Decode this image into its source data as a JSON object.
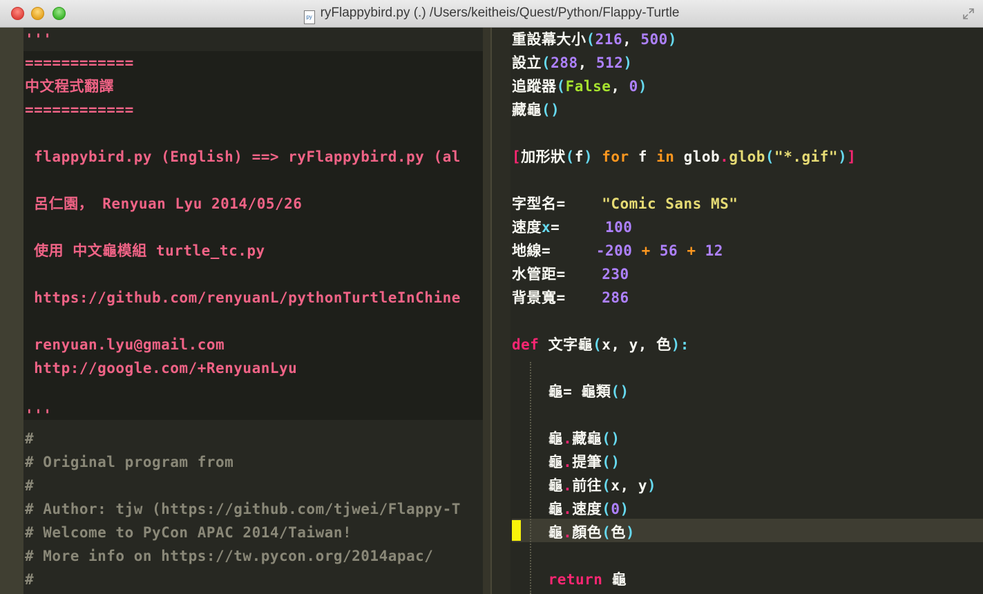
{
  "window": {
    "title": "ryFlappybird.py (.) /Users/keitheis/Quest/Python/Flappy-Turtle",
    "file_icon_label": "py"
  },
  "left_pane": {
    "lines": [
      {
        "text": "'''",
        "cls": "str"
      },
      {
        "text": "============",
        "cls": "str"
      },
      {
        "text": "中文程式翻譯",
        "cls": "str"
      },
      {
        "text": "============",
        "cls": "str"
      },
      {
        "text": "",
        "cls": "str"
      },
      {
        "text": " flappybird.py (English) ==> ryFlappybird.py (al",
        "cls": "str"
      },
      {
        "text": "",
        "cls": "str"
      },
      {
        "text": " 呂仁園， Renyuan Lyu 2014/05/26",
        "cls": "str"
      },
      {
        "text": "",
        "cls": "str"
      },
      {
        "text": " 使用 中文龜模組 turtle_tc.py",
        "cls": "str"
      },
      {
        "text": "",
        "cls": "str"
      },
      {
        "text": " https://github.com/renyuanL/pythonTurtleInChine",
        "cls": "str"
      },
      {
        "text": "",
        "cls": "str"
      },
      {
        "text": " renyuan.lyu@gmail.com",
        "cls": "str"
      },
      {
        "text": " http://google.com/+RenyuanLyu",
        "cls": "str"
      },
      {
        "text": "",
        "cls": "str"
      },
      {
        "text": "'''",
        "cls": "str"
      },
      {
        "text": "#",
        "cls": "cmt"
      },
      {
        "text": "# Original program from",
        "cls": "cmt"
      },
      {
        "text": "#",
        "cls": "cmt"
      },
      {
        "text": "# Author: tjw (https://github.com/tjwei/Flappy-T",
        "cls": "cmt"
      },
      {
        "text": "# Welcome to PyCon APAC 2014/Taiwan!",
        "cls": "cmt"
      },
      {
        "text": "# More info on https://tw.pycon.org/2014apac/",
        "cls": "cmt"
      },
      {
        "text": "#",
        "cls": "cmt"
      }
    ]
  },
  "right_pane": {
    "lines": [
      [
        {
          "t": "重設幕大小",
          "c": "white"
        },
        {
          "t": "(",
          "c": "cyan"
        },
        {
          "t": "216",
          "c": "purple"
        },
        {
          "t": ", ",
          "c": "white"
        },
        {
          "t": "500",
          "c": "purple"
        },
        {
          "t": ")",
          "c": "cyan"
        }
      ],
      [
        {
          "t": "設立",
          "c": "white"
        },
        {
          "t": "(",
          "c": "cyan"
        },
        {
          "t": "288",
          "c": "purple"
        },
        {
          "t": ", ",
          "c": "white"
        },
        {
          "t": "512",
          "c": "purple"
        },
        {
          "t": ")",
          "c": "cyan"
        }
      ],
      [
        {
          "t": "追蹤器",
          "c": "white"
        },
        {
          "t": "(",
          "c": "cyan"
        },
        {
          "t": "False",
          "c": "green"
        },
        {
          "t": ", ",
          "c": "white"
        },
        {
          "t": "0",
          "c": "purple"
        },
        {
          "t": ")",
          "c": "cyan"
        }
      ],
      [
        {
          "t": "藏龜",
          "c": "white"
        },
        {
          "t": "()",
          "c": "cyan"
        }
      ],
      [],
      [
        {
          "t": "[",
          "c": "red"
        },
        {
          "t": "加形狀",
          "c": "white"
        },
        {
          "t": "(",
          "c": "cyan"
        },
        {
          "t": "f",
          "c": "white"
        },
        {
          "t": ")",
          "c": "cyan"
        },
        {
          "t": " for ",
          "c": "orange"
        },
        {
          "t": "f",
          "c": "white"
        },
        {
          "t": " in ",
          "c": "orange"
        },
        {
          "t": "glob",
          "c": "white"
        },
        {
          "t": ".",
          "c": "pink"
        },
        {
          "t": "glob",
          "c": "yellow"
        },
        {
          "t": "(",
          "c": "cyan"
        },
        {
          "t": "\"*.gif\"",
          "c": "yellow"
        },
        {
          "t": ")",
          "c": "cyan"
        },
        {
          "t": "]",
          "c": "red"
        }
      ],
      [],
      [
        {
          "t": "字型名= ",
          "c": "white"
        },
        {
          "t": "   \"Comic Sans MS\"",
          "c": "yellow"
        }
      ],
      [
        {
          "t": "速度",
          "c": "white"
        },
        {
          "t": "x",
          "c": "cyan"
        },
        {
          "t": "= ",
          "c": "white"
        },
        {
          "t": "    100",
          "c": "purple"
        }
      ],
      [
        {
          "t": "地線=",
          "c": "white"
        },
        {
          "t": "     -200",
          "c": "purple"
        },
        {
          "t": " + ",
          "c": "orange"
        },
        {
          "t": "56",
          "c": "purple"
        },
        {
          "t": " + ",
          "c": "orange"
        },
        {
          "t": "12",
          "c": "purple"
        }
      ],
      [
        {
          "t": "水管距=",
          "c": "white"
        },
        {
          "t": "    230",
          "c": "purple"
        }
      ],
      [
        {
          "t": "背景寬=",
          "c": "white"
        },
        {
          "t": "    286",
          "c": "purple"
        }
      ],
      [],
      [
        {
          "t": "def ",
          "c": "def"
        },
        {
          "t": "文字龜",
          "c": "white"
        },
        {
          "t": "(",
          "c": "cyan"
        },
        {
          "t": "x, y, 色",
          "c": "white"
        },
        {
          "t": "):",
          "c": "cyan"
        }
      ],
      [],
      [
        {
          "t": "    龜= 龜類",
          "c": "white"
        },
        {
          "t": "()",
          "c": "cyan"
        }
      ],
      [],
      [
        {
          "t": "    龜",
          "c": "white"
        },
        {
          "t": ".",
          "c": "pink"
        },
        {
          "t": "藏龜",
          "c": "white"
        },
        {
          "t": "()",
          "c": "cyan"
        }
      ],
      [
        {
          "t": "    龜",
          "c": "white"
        },
        {
          "t": ".",
          "c": "pink"
        },
        {
          "t": "提筆",
          "c": "white"
        },
        {
          "t": "()",
          "c": "cyan"
        }
      ],
      [
        {
          "t": "    龜",
          "c": "white"
        },
        {
          "t": ".",
          "c": "pink"
        },
        {
          "t": "前往",
          "c": "white"
        },
        {
          "t": "(",
          "c": "cyan"
        },
        {
          "t": "x, y",
          "c": "white"
        },
        {
          "t": ")",
          "c": "cyan"
        }
      ],
      [
        {
          "t": "    龜",
          "c": "white"
        },
        {
          "t": ".",
          "c": "pink"
        },
        {
          "t": "速度",
          "c": "white"
        },
        {
          "t": "(",
          "c": "cyan"
        },
        {
          "t": "0",
          "c": "purple"
        },
        {
          "t": ")",
          "c": "cyan"
        }
      ],
      [
        {
          "t": "    龜",
          "c": "white"
        },
        {
          "t": ".",
          "c": "pink"
        },
        {
          "t": "顏色",
          "c": "white"
        },
        {
          "t": "(",
          "c": "cyan"
        },
        {
          "t": "色",
          "c": "white"
        },
        {
          "t": ")",
          "c": "cyan"
        }
      ],
      [],
      [
        {
          "t": "    return ",
          "c": "kw"
        },
        {
          "t": "龜",
          "c": "white"
        }
      ]
    ]
  }
}
